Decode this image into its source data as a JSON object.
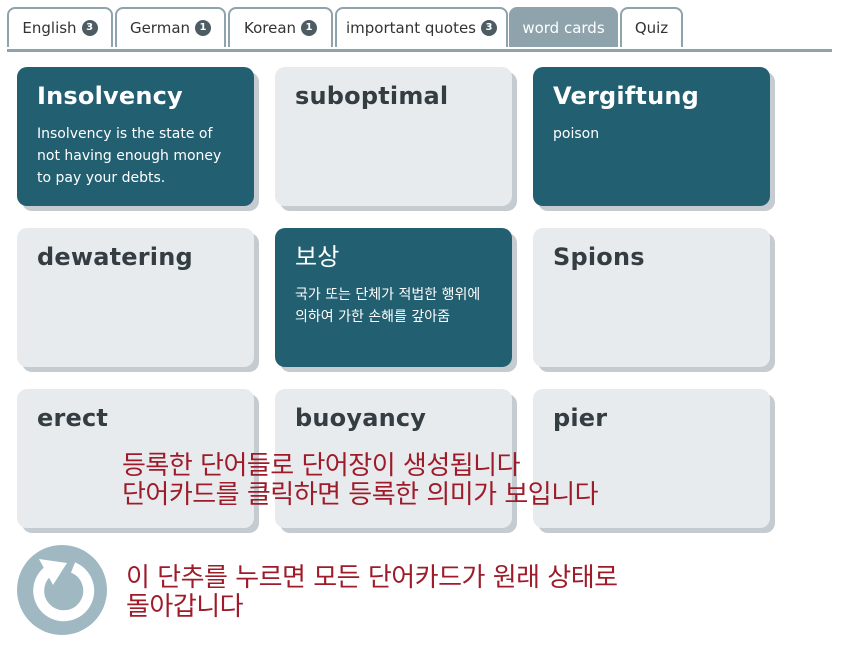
{
  "tabs": [
    {
      "label": "English",
      "badge": "3"
    },
    {
      "label": "German",
      "badge": "1"
    },
    {
      "label": "Korean",
      "badge": "1"
    },
    {
      "label": "important quotes",
      "badge": "3"
    },
    {
      "label": "word cards",
      "badge": null
    },
    {
      "label": "Quiz",
      "badge": null
    }
  ],
  "cards": [
    {
      "word": "Insolvency",
      "meaning": "Insolvency is the state of not having enough money to pay your debts.",
      "flipped": true
    },
    {
      "word": "suboptimal",
      "meaning": "",
      "flipped": false
    },
    {
      "word": "Vergiftung",
      "meaning": "poison",
      "flipped": true
    },
    {
      "word": "dewatering",
      "meaning": "",
      "flipped": false
    },
    {
      "word": "보상",
      "meaning": "국가 또는 단체가 적법한 행위에 의하여 가한 손해를 갚아줌",
      "flipped": true
    },
    {
      "word": "Spions",
      "meaning": "",
      "flipped": false
    },
    {
      "word": "erect",
      "meaning": "",
      "flipped": false
    },
    {
      "word": "buoyancy",
      "meaning": "",
      "flipped": false
    },
    {
      "word": "pier",
      "meaning": "",
      "flipped": false
    }
  ],
  "instructions": {
    "cards_line1": "등록한 단어들로 단어장이 생성됩니다",
    "cards_line2": "단어카드를 클릭하면 등록한 의미가 보입니다",
    "reset_line1": "이 단추를 누르면 모든 단어카드가 원래 상태로",
    "reset_line2": "돌아갑니다"
  },
  "reset_button": {
    "icon": "rotate-counterclockwise-icon"
  },
  "colors": {
    "tab_border": "#8fa3ad",
    "tab_active_bg": "#8fa3ad",
    "badge_bg": "#4d5c63",
    "card_light_bg": "#e8ebee",
    "card_dark_bg": "#225f70",
    "card_shadow": "#c4ccd1",
    "instruction_text": "#9e1c2a",
    "reset_button_bg": "#9fb8c2"
  }
}
